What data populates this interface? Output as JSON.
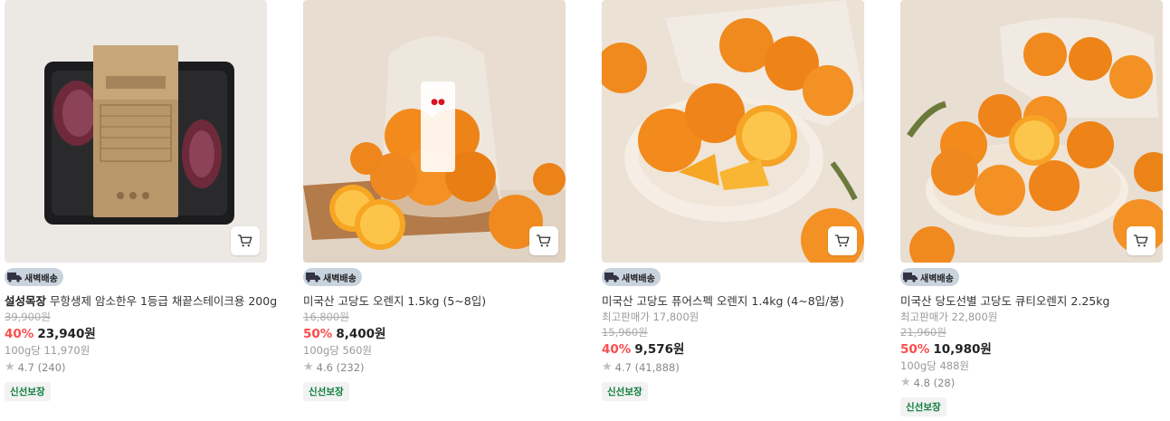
{
  "products": [
    {
      "brand": "설성목장",
      "name": "무항생제 암소한우 1등급 채끝스테이크용 200g",
      "delivery_badge": "새벽배송",
      "reference_price": "",
      "original_price": "39,900원",
      "discount": "40%",
      "price": "23,940원",
      "unit_price": "100g당 11,970원",
      "rating": "4.7 (240)",
      "tag": "신선보장"
    },
    {
      "brand": "",
      "name": "미국산 고당도 오렌지 1.5kg (5~8입)",
      "delivery_badge": "새벽배송",
      "reference_price": "",
      "original_price": "16,800원",
      "discount": "50%",
      "price": "8,400원",
      "unit_price": "100g당 560원",
      "rating": "4.6 (232)",
      "tag": "신선보장"
    },
    {
      "brand": "",
      "name": "미국산 고당도 퓨어스펙 오렌지 1.4kg (4~8입/봉)",
      "delivery_badge": "새벽배송",
      "reference_price": "최고판매가 17,800원",
      "original_price": "15,960원",
      "discount": "40%",
      "price": "9,576원",
      "unit_price": "",
      "rating": "4.7 (41,888)",
      "tag": "신선보장"
    },
    {
      "brand": "",
      "name": "미국산 당도선별 고당도 큐티오렌지 2.25kg",
      "delivery_badge": "새벽배송",
      "reference_price": "최고판매가 22,800원",
      "original_price": "21,960원",
      "discount": "50%",
      "price": "10,980원",
      "unit_price": "100g당 488원",
      "rating": "4.8 (28)",
      "tag": "신선보장"
    }
  ],
  "colors": {
    "discount": "#fa4d4d",
    "fresh_tag": "#0a7c3a",
    "badge_bg": "#c9d3de"
  }
}
